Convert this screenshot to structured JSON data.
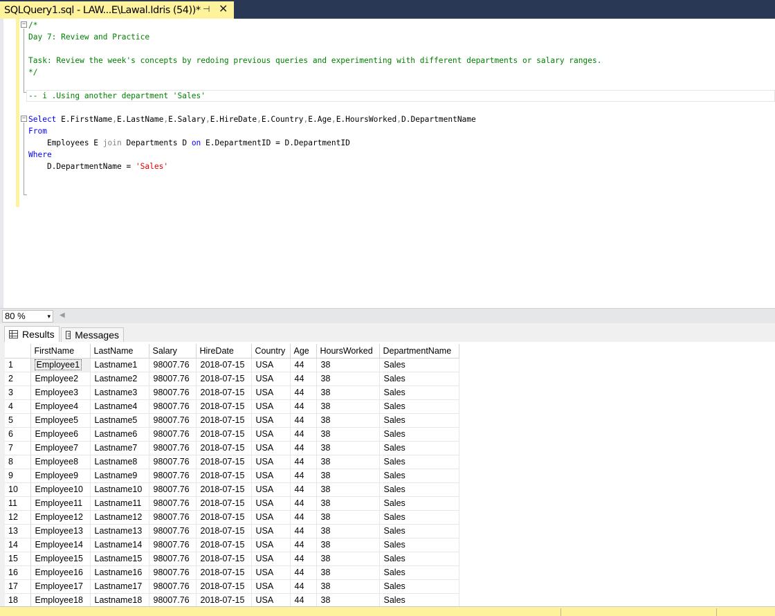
{
  "document_tab": {
    "title": "SQLQuery1.sql - LAW...E\\Lawal.Idris (54))*",
    "pin_glyph": "⊣",
    "close_glyph": "✕"
  },
  "editor": {
    "comment_lines": [
      "/*",
      "Day 7: Review and Practice",
      "",
      "Task: Review the week's concepts by redoing previous queries and experimenting with different departments or salary ranges.",
      "*/",
      "",
      "-- i .Using another department 'Sales'"
    ],
    "query": {
      "select_kw": "Select",
      "select_cols": [
        {
          "alias": "E",
          "col": "FirstName"
        },
        {
          "alias": "E",
          "col": "LastName"
        },
        {
          "alias": "E",
          "col": "Salary"
        },
        {
          "alias": "E",
          "col": "HireDate"
        },
        {
          "alias": "E",
          "col": "Country"
        },
        {
          "alias": "E",
          "col": "Age"
        },
        {
          "alias": "E",
          "col": "HoursWorked"
        },
        {
          "alias": "D",
          "col": "DepartmentName"
        }
      ],
      "from_kw": "From",
      "from_table": "Employees E",
      "join_kw": "join",
      "join_table": "Departments D",
      "on_kw": "on",
      "on_condition": "E.DepartmentID = D.DepartmentID",
      "where_kw": "Where",
      "where_left": "D.DepartmentName = ",
      "where_value": "'Sales'"
    }
  },
  "zoom": {
    "value": "80 %",
    "arrow": "▾"
  },
  "result_tabs": [
    {
      "label": "Results",
      "icon": "grid-icon",
      "active": true
    },
    {
      "label": "Messages",
      "icon": "messages-icon",
      "active": false
    }
  ],
  "results": {
    "columns": [
      "FirstName",
      "LastName",
      "Salary",
      "HireDate",
      "Country",
      "Age",
      "HoursWorked",
      "DepartmentName"
    ],
    "rows": [
      [
        "1",
        "Employee1",
        "Lastname1",
        "98007.76",
        "2018-07-15",
        "USA",
        "44",
        "38",
        "Sales"
      ],
      [
        "2",
        "Employee2",
        "Lastname2",
        "98007.76",
        "2018-07-15",
        "USA",
        "44",
        "38",
        "Sales"
      ],
      [
        "3",
        "Employee3",
        "Lastname3",
        "98007.76",
        "2018-07-15",
        "USA",
        "44",
        "38",
        "Sales"
      ],
      [
        "4",
        "Employee4",
        "Lastname4",
        "98007.76",
        "2018-07-15",
        "USA",
        "44",
        "38",
        "Sales"
      ],
      [
        "5",
        "Employee5",
        "Lastname5",
        "98007.76",
        "2018-07-15",
        "USA",
        "44",
        "38",
        "Sales"
      ],
      [
        "6",
        "Employee6",
        "Lastname6",
        "98007.76",
        "2018-07-15",
        "USA",
        "44",
        "38",
        "Sales"
      ],
      [
        "7",
        "Employee7",
        "Lastname7",
        "98007.76",
        "2018-07-15",
        "USA",
        "44",
        "38",
        "Sales"
      ],
      [
        "8",
        "Employee8",
        "Lastname8",
        "98007.76",
        "2018-07-15",
        "USA",
        "44",
        "38",
        "Sales"
      ],
      [
        "9",
        "Employee9",
        "Lastname9",
        "98007.76",
        "2018-07-15",
        "USA",
        "44",
        "38",
        "Sales"
      ],
      [
        "10",
        "Employee10",
        "Lastname10",
        "98007.76",
        "2018-07-15",
        "USA",
        "44",
        "38",
        "Sales"
      ],
      [
        "11",
        "Employee11",
        "Lastname11",
        "98007.76",
        "2018-07-15",
        "USA",
        "44",
        "38",
        "Sales"
      ],
      [
        "12",
        "Employee12",
        "Lastname12",
        "98007.76",
        "2018-07-15",
        "USA",
        "44",
        "38",
        "Sales"
      ],
      [
        "13",
        "Employee13",
        "Lastname13",
        "98007.76",
        "2018-07-15",
        "USA",
        "44",
        "38",
        "Sales"
      ],
      [
        "14",
        "Employee14",
        "Lastname14",
        "98007.76",
        "2018-07-15",
        "USA",
        "44",
        "38",
        "Sales"
      ],
      [
        "15",
        "Employee15",
        "Lastname15",
        "98007.76",
        "2018-07-15",
        "USA",
        "44",
        "38",
        "Sales"
      ],
      [
        "16",
        "Employee16",
        "Lastname16",
        "98007.76",
        "2018-07-15",
        "USA",
        "44",
        "38",
        "Sales"
      ],
      [
        "17",
        "Employee17",
        "Lastname17",
        "98007.76",
        "2018-07-15",
        "USA",
        "44",
        "38",
        "Sales"
      ],
      [
        "18",
        "Employee18",
        "Lastname18",
        "98007.76",
        "2018-07-15",
        "USA",
        "44",
        "38",
        "Sales"
      ]
    ],
    "selected_cell": "Employee1"
  },
  "colors": {
    "tab_yellow": "#fff29d",
    "chrome_navy": "#293955",
    "keyword_blue": "#0000ff",
    "comment_green": "#008000",
    "string_red": "#e00000",
    "operator_gray": "#808080"
  }
}
